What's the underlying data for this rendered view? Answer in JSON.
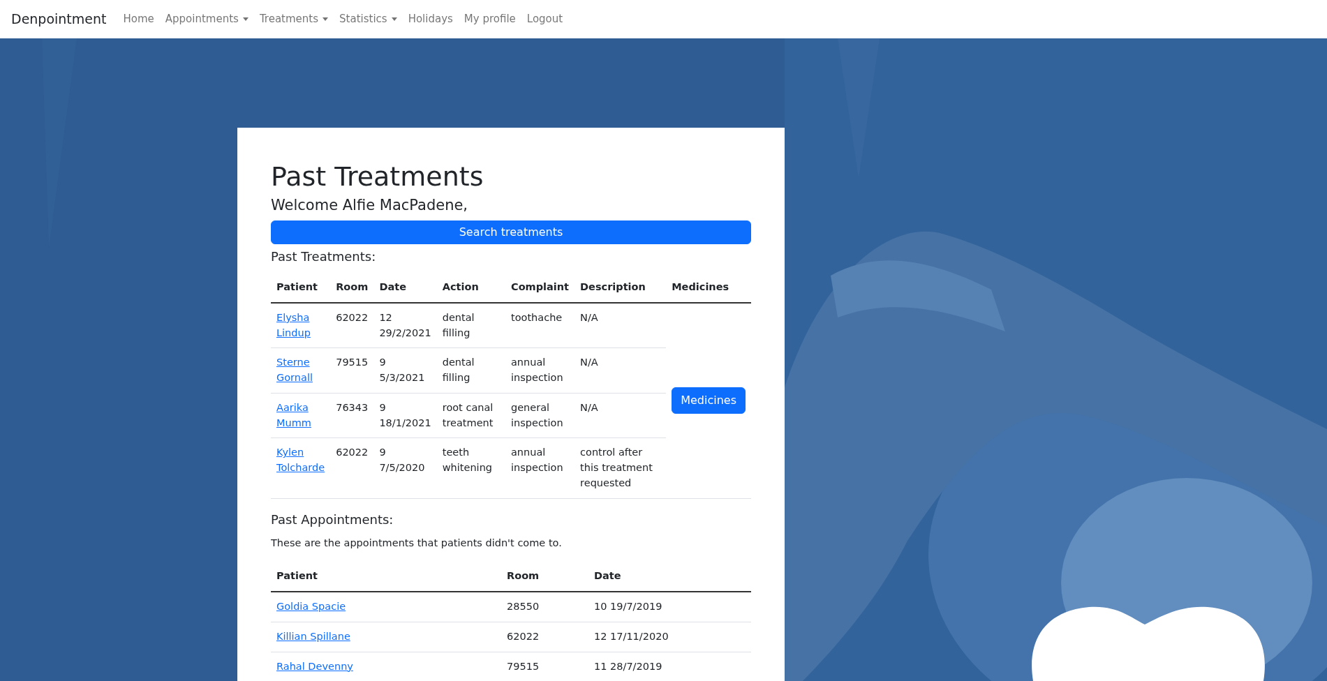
{
  "navbar": {
    "brand": "Denpointment",
    "items": [
      {
        "label": "Home",
        "dropdown": false
      },
      {
        "label": "Appointments",
        "dropdown": true
      },
      {
        "label": "Treatments",
        "dropdown": true
      },
      {
        "label": "Statistics",
        "dropdown": true
      },
      {
        "label": "Holidays",
        "dropdown": false
      },
      {
        "label": "My profile",
        "dropdown": false
      },
      {
        "label": "Logout",
        "dropdown": false
      }
    ]
  },
  "page": {
    "title": "Past Treatments",
    "welcome": "Welcome Alfie MacPadene,",
    "search_button": "Search treatments"
  },
  "treatments": {
    "heading": "Past Treatments:",
    "columns": [
      "Patient",
      "Room",
      "Date",
      "Action",
      "Complaint",
      "Description",
      "Medicines"
    ],
    "rows": [
      {
        "patient": "Elysha Lindup",
        "room": "62022",
        "date": "12 29/2/2021",
        "action": "dental filling",
        "complaint": "toothache",
        "description": "N/A"
      },
      {
        "patient": "Sterne Gornall",
        "room": "79515",
        "date": "9 5/3/2021",
        "action": "dental filling",
        "complaint": "annual inspection",
        "description": "N/A"
      },
      {
        "patient": "Aarika Mumm",
        "room": "76343",
        "date": "9 18/1/2021",
        "action": "root canal treatment",
        "complaint": "general inspection",
        "description": "N/A"
      },
      {
        "patient": "Kylen Tolcharde",
        "room": "62022",
        "date": "9 7/5/2020",
        "action": "teeth whitening",
        "complaint": "annual inspection",
        "description": "control after this treatment requested"
      }
    ],
    "medicines_button": "Medicines"
  },
  "appointments": {
    "heading": "Past Appointments:",
    "note": "These are the appointments that patients didn't come to.",
    "columns": [
      "Patient",
      "Room",
      "Date"
    ],
    "rows": [
      {
        "patient": "Goldia Spacie",
        "room": "28550",
        "date": "10 19/7/2019"
      },
      {
        "patient": "Killian Spillane",
        "room": "62022",
        "date": "12 17/11/2020"
      },
      {
        "patient": "Rahal Devenny",
        "room": "79515",
        "date": "11 28/7/2019"
      }
    ]
  }
}
